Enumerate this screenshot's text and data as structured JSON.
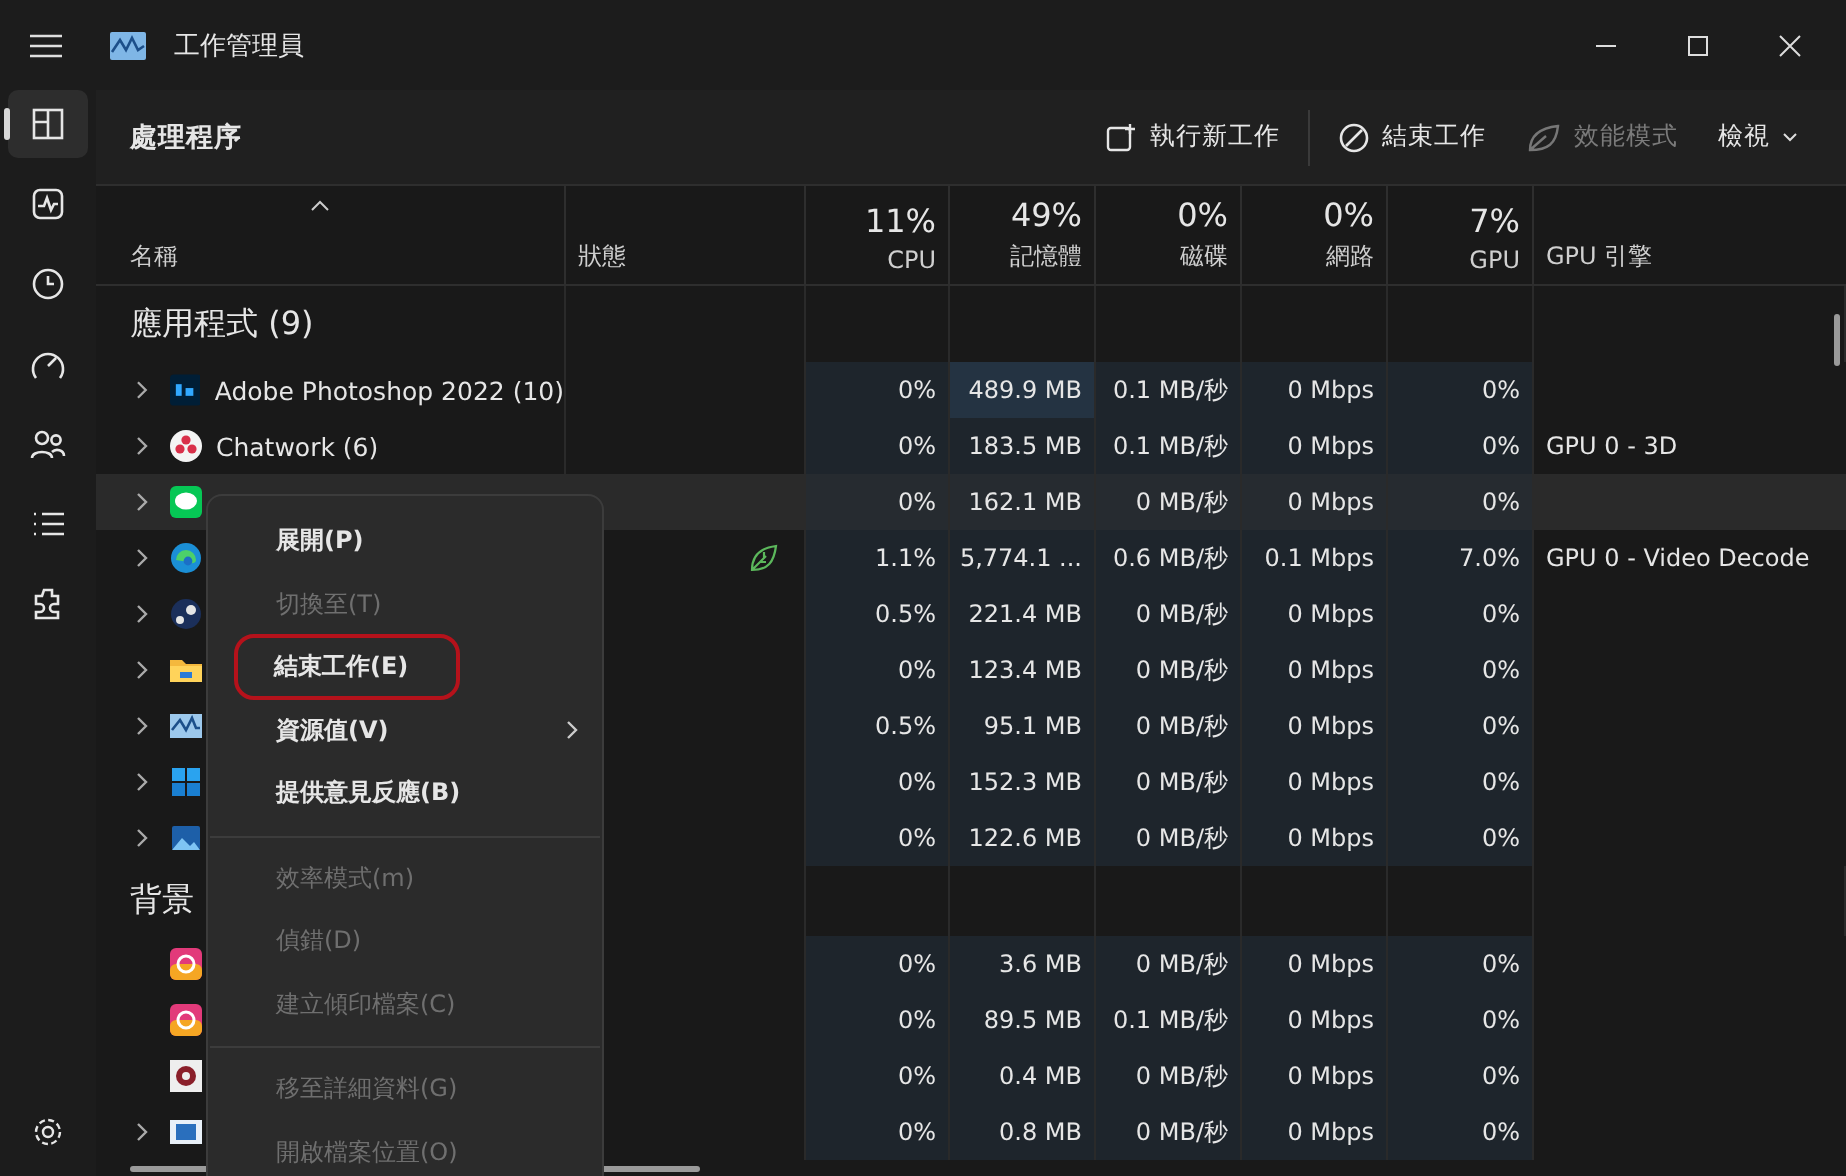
{
  "window": {
    "title": "工作管理員"
  },
  "sidebar": {
    "items": [
      {
        "selected": true
      },
      {
        "selected": false
      },
      {
        "selected": false
      },
      {
        "selected": false
      },
      {
        "selected": false
      },
      {
        "selected": false
      },
      {
        "selected": false
      }
    ]
  },
  "page_title": "處理程序",
  "toolbar": [
    {
      "kind": "run",
      "label": "執行新工作",
      "disabled": false
    },
    {
      "kind": "end",
      "label": "結束工作",
      "disabled": false
    },
    {
      "kind": "eco",
      "label": "效能模式",
      "disabled": true
    },
    {
      "kind": "view",
      "label": "檢視",
      "disabled": false
    }
  ],
  "columns": [
    {
      "label": "名稱"
    },
    {
      "label": "狀態"
    },
    {
      "label": "CPU",
      "total": "11%"
    },
    {
      "label": "記憶體",
      "total": "49%"
    },
    {
      "label": "磁碟",
      "total": "0%"
    },
    {
      "label": "網路",
      "total": "0%"
    },
    {
      "label": "GPU",
      "total": "7%"
    },
    {
      "label": "GPU 引擎"
    }
  ],
  "groups": [
    {
      "title": "應用程式 (9)",
      "rows": [
        {
          "name": "Adobe Photoshop 2022 (10)",
          "expandable": true,
          "efficiency_mode": false,
          "highlighted": false,
          "cpu": "0%",
          "memory": "489.9 MB",
          "disk": "0.1 MB/秒",
          "network": "0 Mbps",
          "gpu": "0%"
        },
        {
          "name": "Chatwork (6)",
          "expandable": true,
          "efficiency_mode": false,
          "highlighted": false,
          "cpu": "0%",
          "memory": "183.5 MB",
          "disk": "0.1 MB/秒",
          "network": "0 Mbps",
          "gpu": "0%",
          "gpu_engine": "GPU 0 - 3D"
        },
        {
          "expandable": true,
          "efficiency_mode": false,
          "highlighted": true,
          "cpu": "0%",
          "memory": "162.1 MB",
          "disk": "0 MB/秒",
          "network": "0 Mbps",
          "gpu": "0%"
        },
        {
          "expandable": true,
          "efficiency_mode": true,
          "highlighted": false,
          "cpu": "1.1%",
          "memory": "5,774.1 ...",
          "disk": "0.6 MB/秒",
          "network": "0.1 Mbps",
          "gpu": "7.0%",
          "gpu_engine": "GPU 0 - Video Decode"
        },
        {
          "expandable": true,
          "efficiency_mode": false,
          "highlighted": false,
          "cpu": "0.5%",
          "memory": "221.4 MB",
          "disk": "0 MB/秒",
          "network": "0 Mbps",
          "gpu": "0%"
        },
        {
          "expandable": true,
          "efficiency_mode": false,
          "highlighted": false,
          "cpu": "0%",
          "memory": "123.4 MB",
          "disk": "0 MB/秒",
          "network": "0 Mbps",
          "gpu": "0%"
        },
        {
          "expandable": true,
          "efficiency_mode": false,
          "highlighted": false,
          "cpu": "0.5%",
          "memory": "95.1 MB",
          "disk": "0 MB/秒",
          "network": "0 Mbps",
          "gpu": "0%"
        },
        {
          "expandable": true,
          "efficiency_mode": false,
          "highlighted": false,
          "cpu": "0%",
          "memory": "152.3 MB",
          "disk": "0 MB/秒",
          "network": "0 Mbps",
          "gpu": "0%"
        },
        {
          "expandable": true,
          "efficiency_mode": false,
          "highlighted": false,
          "cpu": "0%",
          "memory": "122.6 MB",
          "disk": "0 MB/秒",
          "network": "0 Mbps",
          "gpu": "0%"
        }
      ]
    },
    {
      "title": "背景",
      "rows": [
        {
          "expandable": false,
          "efficiency_mode": false,
          "highlighted": false,
          "cpu": "0%",
          "memory": "3.6 MB",
          "disk": "0 MB/秒",
          "network": "0 Mbps",
          "gpu": "0%"
        },
        {
          "expandable": false,
          "efficiency_mode": false,
          "highlighted": false,
          "cpu": "0%",
          "memory": "89.5 MB",
          "disk": "0.1 MB/秒",
          "network": "0 Mbps",
          "gpu": "0%"
        },
        {
          "expandable": false,
          "efficiency_mode": false,
          "highlighted": false,
          "cpu": "0%",
          "memory": "0.4 MB",
          "disk": "0 MB/秒",
          "network": "0 Mbps",
          "gpu": "0%"
        },
        {
          "expandable": true,
          "efficiency_mode": false,
          "highlighted": false,
          "cpu": "0%",
          "memory": "0.8 MB",
          "disk": "0 MB/秒",
          "network": "0 Mbps",
          "gpu": "0%"
        }
      ]
    }
  ],
  "context_menu": {
    "items": [
      {
        "kind": "item",
        "label": "展開(P)",
        "disabled": false,
        "highlighted": false
      },
      {
        "kind": "item",
        "label": "切換至(T)",
        "disabled": true,
        "highlighted": false
      },
      {
        "kind": "item",
        "label": "結束工作(E)",
        "disabled": false,
        "highlighted": true
      },
      {
        "kind": "submenu",
        "label": "資源值(V)",
        "disabled": false,
        "highlighted": false
      },
      {
        "kind": "item",
        "label": "提供意見反應(B)",
        "disabled": false,
        "highlighted": false
      },
      {
        "kind": "divider"
      },
      {
        "kind": "item",
        "label": "效率模式(m)",
        "disabled": true,
        "highlighted": false
      },
      {
        "kind": "item",
        "label": "偵錯(D)",
        "disabled": true,
        "highlighted": false
      },
      {
        "kind": "item",
        "label": "建立傾印檔案(C)",
        "disabled": true,
        "highlighted": false
      },
      {
        "kind": "divider"
      },
      {
        "kind": "item",
        "label": "移至詳細資料(G)",
        "disabled": true,
        "highlighted": false
      },
      {
        "kind": "item",
        "label": "開啟檔案位置(O)",
        "disabled": true,
        "highlighted": false
      }
    ]
  }
}
